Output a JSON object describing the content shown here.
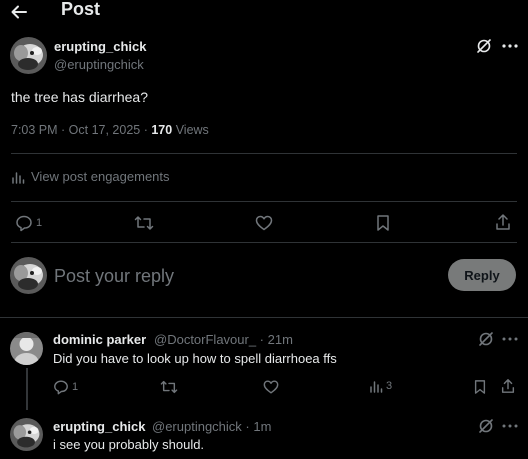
{
  "header": {
    "title": "Post"
  },
  "post": {
    "author_name": "erupting_chick",
    "author_handle": "@eruptingchick",
    "text": "the tree has diarrhea?",
    "meta_datetime": "7:03 PM · Oct 17, 2025 · ",
    "views_count": "170",
    "views_label": " Views",
    "engagements_label": "View post engagements",
    "reply_count": "1"
  },
  "composer": {
    "placeholder": "Post your reply",
    "reply_label": "Reply"
  },
  "replies": [
    {
      "name": "dominic parker",
      "handle_time": "@DoctorFlavour_ · 21m",
      "text": "Did you have to look up how to spell diarrhoea ffs",
      "reply_count": "1",
      "views_count": "3"
    },
    {
      "name": "erupting_chick",
      "handle_time": "@eruptingchick · 1m",
      "text": "i see you probably should."
    }
  ],
  "colors": {
    "background": "#000000",
    "text_primary": "#e7e9ea",
    "text_secondary": "#71767b",
    "divider": "#2f3336",
    "reply_button": "#787a7a"
  },
  "icons": [
    "back-arrow-icon",
    "grok-icon",
    "more-icon",
    "analytics-icon",
    "reply-icon",
    "repost-icon",
    "like-icon",
    "bookmark-icon",
    "share-icon"
  ]
}
